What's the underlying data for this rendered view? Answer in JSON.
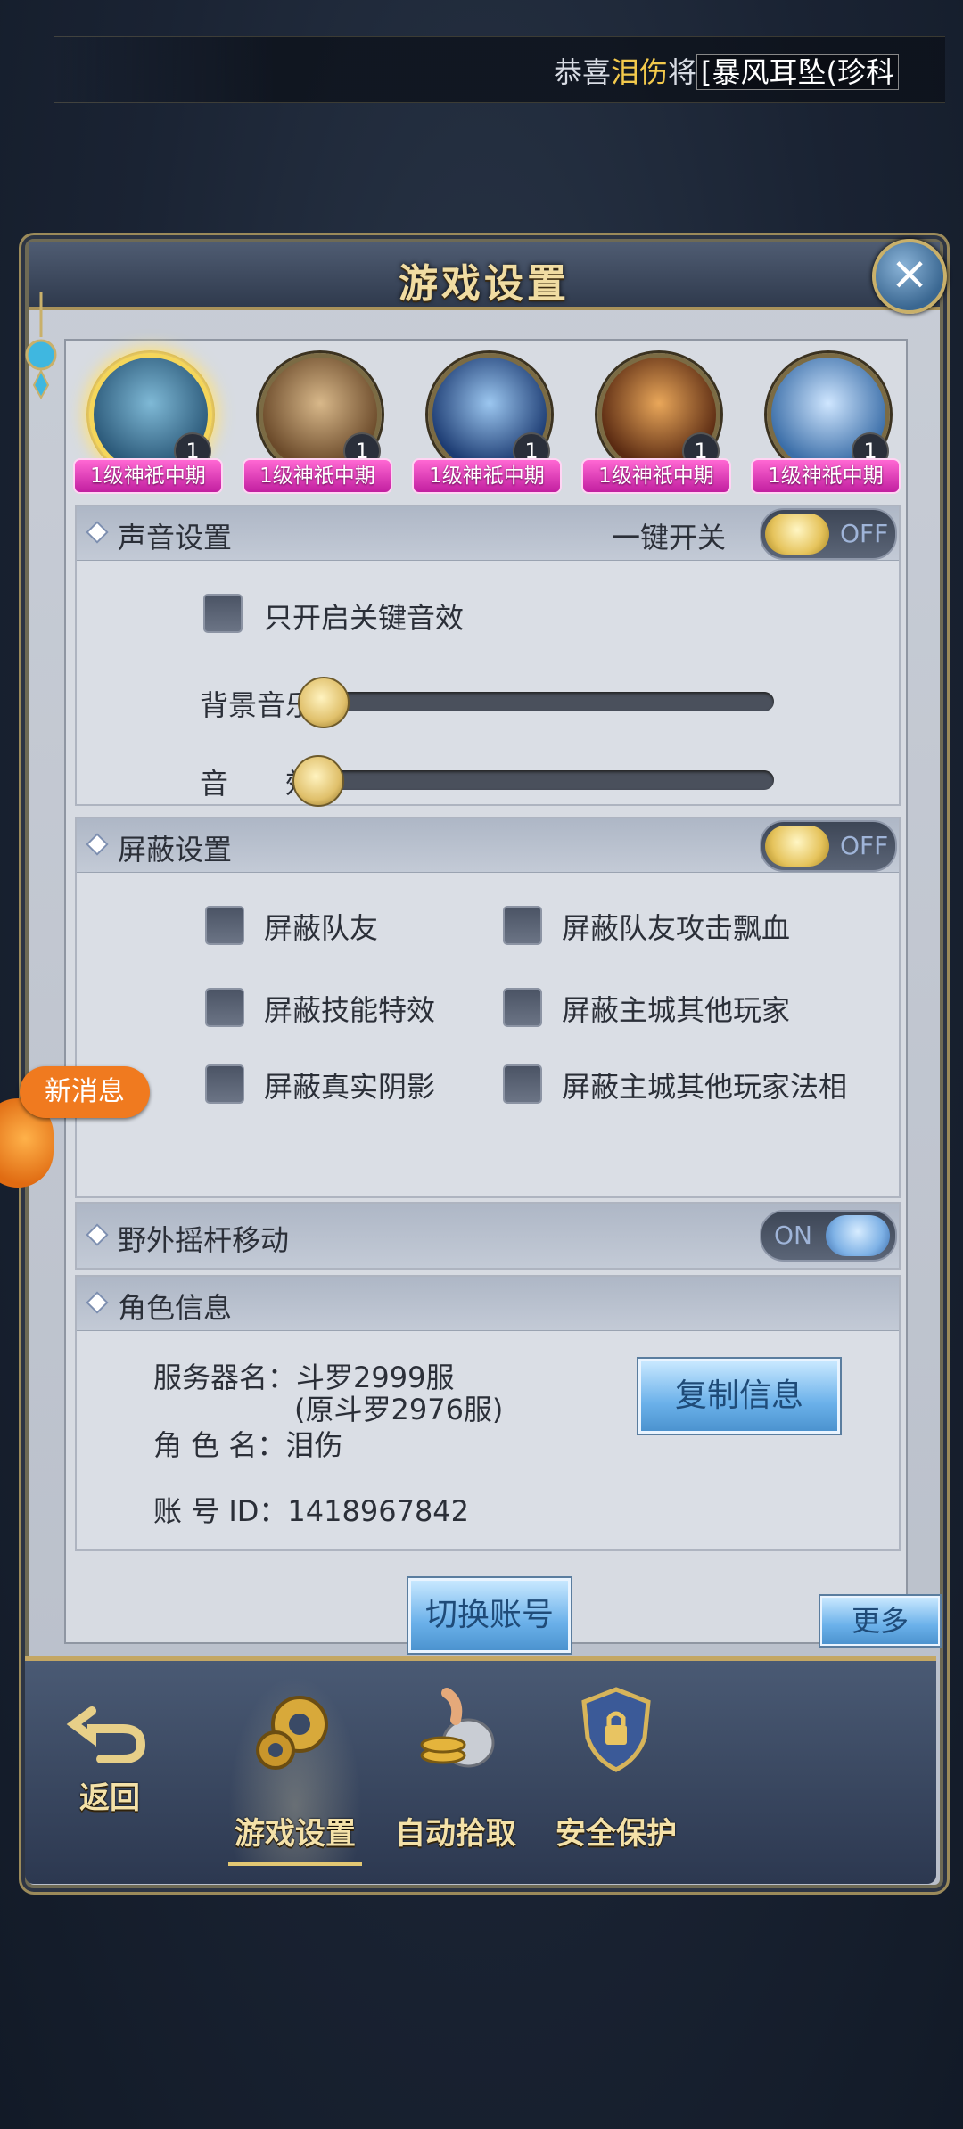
{
  "ticker": {
    "prefix": "恭喜",
    "name": "泪伤",
    "verb": "将",
    "item": "[暴风耳坠(珍科"
  },
  "panel": {
    "title": "游戏设置",
    "close_icon": "×"
  },
  "avatars": [
    {
      "level": "1",
      "rank": "1级神祇中期",
      "selected": true
    },
    {
      "level": "1",
      "rank": "1级神祇中期",
      "selected": false
    },
    {
      "level": "1",
      "rank": "1级神祇中期",
      "selected": false
    },
    {
      "level": "1",
      "rank": "1级神祇中期",
      "selected": false
    },
    {
      "level": "1",
      "rank": "1级神祇中期",
      "selected": false
    }
  ],
  "sound": {
    "title": "声音设置",
    "master_label": "一键开关",
    "master_toggle": "OFF",
    "only_key_label": "只开启关键音效",
    "bgm_label": "背景音乐",
    "sfx_label": "音　　效",
    "bgm_level": 0,
    "sfx_level": 0
  },
  "shield": {
    "title": "屏蔽设置",
    "toggle": "OFF",
    "options": [
      "屏蔽队友",
      "屏蔽队友攻击飘血",
      "屏蔽技能特效",
      "屏蔽主城其他玩家",
      "屏蔽真实阴影",
      "屏蔽主城其他玩家法相"
    ]
  },
  "joystick": {
    "title": "野外摇杆移动",
    "toggle": "ON"
  },
  "role": {
    "title": "角色信息",
    "server_line": "服务器名：斗罗2999服",
    "server_sub": "(原斗罗2976服)",
    "name_line": "角 色 名：泪伤",
    "id_line": "账 号 ID：1418967842",
    "copy_button": "复制信息"
  },
  "actions": {
    "switch_account": "切换账号",
    "more": "更多"
  },
  "bottom_nav": {
    "back": "返回",
    "items": [
      "游戏设置",
      "自动拾取",
      "安全保护"
    ]
  },
  "floating": {
    "new_message": "新消息"
  }
}
